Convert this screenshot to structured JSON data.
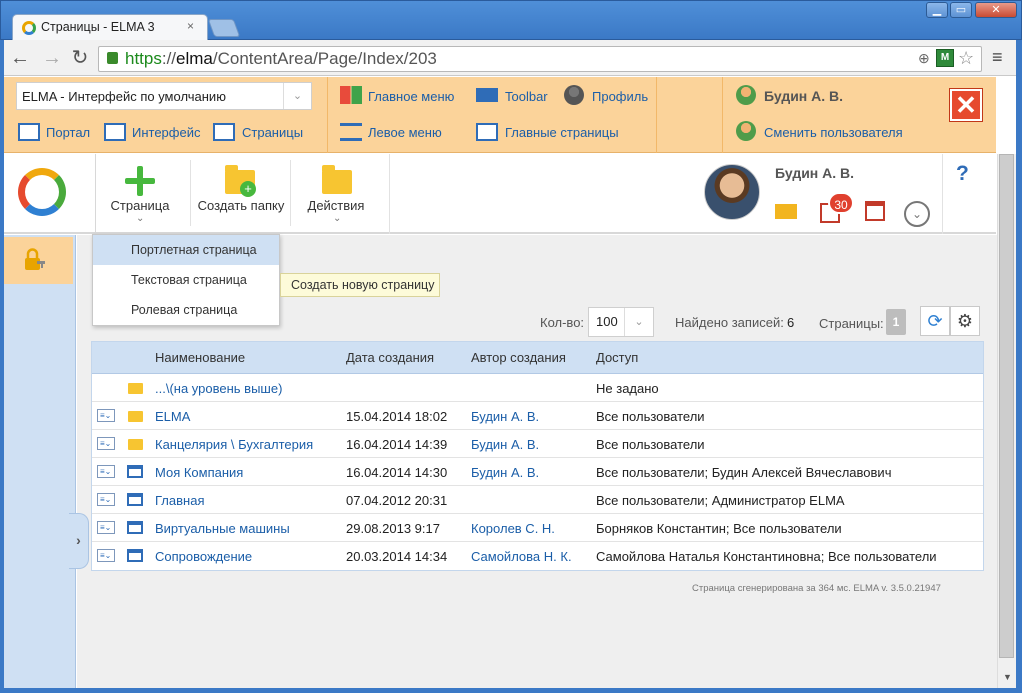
{
  "browser": {
    "tab_title": "Страницы - ELMA 3",
    "tab_close": "×",
    "url_https": "https",
    "url_sep": "://",
    "url_host": "elma",
    "url_path": "/ContentArea/Page/Index/203",
    "zoom_icon": "⊕",
    "ext_label": "M",
    "star": "☆",
    "menu": "≡",
    "back": "←",
    "forward": "→",
    "reload": "↻",
    "min": "▁",
    "max": "▭",
    "close": "✕"
  },
  "header": {
    "interface_select": "ELMA  - Интерфейс по умолчанию",
    "links": {
      "portal": "Портал",
      "interface": "Интерфейс",
      "pages": "Страницы",
      "main_menu": "Главное меню",
      "toolbar": "Toolbar",
      "profile": "Профиль",
      "left_menu": "Левое меню",
      "main_pages": "Главные страницы"
    },
    "user_name": "Будин А. В.",
    "switch_user": "Сменить пользователя",
    "logout": "✕"
  },
  "toolbar": {
    "page": "Страница",
    "create_folder": "Создать папку",
    "actions": "Действия",
    "chevron": "⌄",
    "user_name": "Будин А. В.",
    "tasks_count": "30",
    "help": "?",
    "more": "⌄"
  },
  "dropdown": {
    "items": [
      "Портлетная страница",
      "Текстовая страница",
      "Ролевая страница"
    ],
    "tooltip": "Создать новую страницу"
  },
  "list": {
    "count_label": "Кол-во:",
    "count_value": "100",
    "found_label": "Найдено записей:",
    "found_value": "6",
    "pages_label": "Страницы:",
    "page_value": "1",
    "refresh": "⟳",
    "settings": "⚙",
    "headers": [
      "Наименование",
      "Дата создания",
      "Автор создания",
      "Доступ"
    ],
    "rows": [
      {
        "name": "...\\(на уровень выше)",
        "date": "",
        "author": "",
        "access": "Не задано"
      },
      {
        "name": "ELMA",
        "date": "15.04.2014 18:02",
        "author": "Будин А. В.",
        "access": "Все пользователи"
      },
      {
        "name": "Канцелярия \\ Бухгалтерия",
        "date": "16.04.2014 14:39",
        "author": "Будин А. В.",
        "access": "Все пользователи"
      },
      {
        "name": "Моя Компания",
        "date": "16.04.2014 14:30",
        "author": "Будин А. В.",
        "access": "Все пользователи; Будин Алексей Вячеславович"
      },
      {
        "name": "Главная",
        "date": "07.04.2012 20:31",
        "author": "",
        "access": "Все пользователи; Администратор ELMA"
      },
      {
        "name": "Виртуальные машины",
        "date": "29.08.2013 9:17",
        "author": "Королев С. Н.",
        "access": "Борняков Константин; Все пользователи"
      },
      {
        "name": "Сопровождение",
        "date": "20.03.2014 14:34",
        "author": "Самойлова Н. К.",
        "access": "Самойлова Наталья Константиновна; Все пользователи"
      }
    ],
    "row_menu_icon": "≡⌄"
  },
  "footer": "Страница сгенерирована за 364 мс. ELMA v. 3.5.0.21947",
  "sidebar": {
    "toggle": "›"
  }
}
